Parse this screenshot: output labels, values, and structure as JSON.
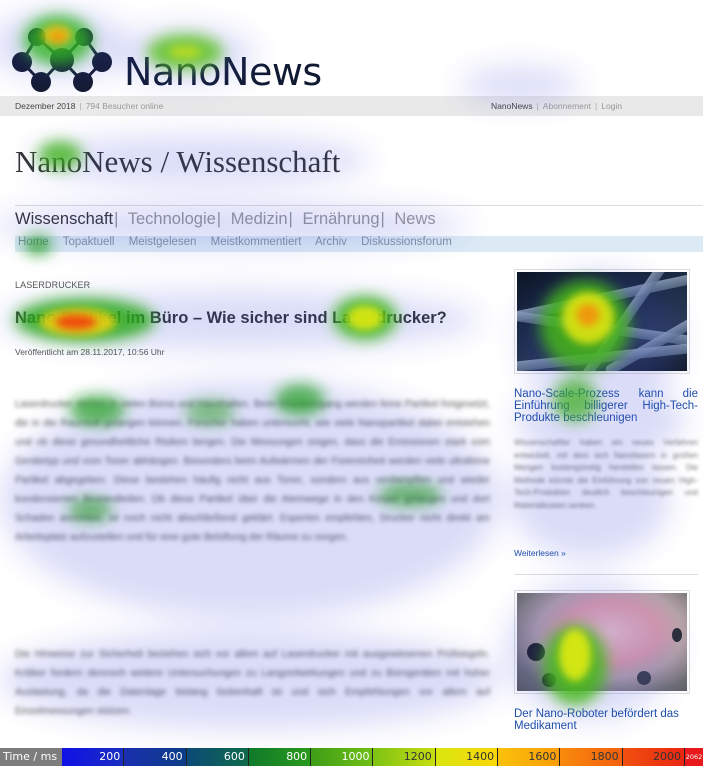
{
  "site": {
    "logo_text": "NanoNews",
    "topbar": {
      "date": "Dezember 2018",
      "visitors": "794 Besucher online",
      "links": [
        "NanoNews",
        "Abonnement",
        "Login"
      ]
    },
    "section_title": "NanoNews / Wissenschaft",
    "category_nav": [
      {
        "label": "Wissenschaft",
        "active": true
      },
      {
        "label": "Technologie",
        "active": false
      },
      {
        "label": "Medizin",
        "active": false
      },
      {
        "label": "Ernährung",
        "active": false
      },
      {
        "label": "News",
        "active": false
      }
    ],
    "sub_nav": [
      "Home",
      "Topaktuell",
      "Meistgelesen",
      "Meistkommentiert",
      "Archiv",
      "Diskussionsforum"
    ]
  },
  "article": {
    "kicker": "LASERDRUCKER",
    "headline": "Nano-Partikel im Büro – Wie sicher sind Laserdrucker?",
    "published": "Veröffentlicht am 28.11.2017, 10:56 Uhr",
    "paragraph_1": "Laserdrucker stehen in vielen Büros und Haushalten. Beim Druckvorgang werden feine Partikel freigesetzt, die in die Raumluft gelangen können. Forscher haben untersucht, wie viele Nanopartikel dabei entstehen und ob diese gesundheitliche Risiken bergen. Die Messungen zeigen, dass die Emissionen stark vom Gerätetyp und vom Toner abhängen. Besonders beim Aufwärmen der Fixiereinheit werden viele ultrafeine Partikel abgegeben. Diese bestehen häufig nicht aus Toner, sondern aus verdampften und wieder kondensierten Bestandteilen. Ob diese Partikel über die Atemwege in den Körper gelangen und dort Schaden anrichten, ist noch nicht abschließend geklärt. Experten empfehlen, Drucker nicht direkt am Arbeitsplatz aufzustellen und für eine gute Belüftung der Räume zu sorgen.",
    "paragraph_2": "Die Hinweise zur Sicherheit beziehen sich vor allem auf Laserdrucker mit ausgewiesenen Prüfsiegeln. Kritiker fordern dennoch weitere Untersuchungen zu Langzeitwirkungen und zu Bürogeräten mit hoher Auslastung, da die Datenlage bislang lückenhaft ist und sich Empfehlungen vor allem auf Einzelmessungen stützen."
  },
  "sidebar": {
    "items": [
      {
        "image_alt": "Elektronenmikroskopische Aufnahme von Nanofasern",
        "title": "Nano-Scale-Prozess kann die Einführung billigerer High-Tech-Produkte beschleunigen",
        "teaser": "Wissenschaftler haben ein neues Verfahren entwickelt, mit dem sich Nanofasern in großen Mengen kostengünstig herstellen lassen. Die Methode könnte die Einführung von neuen High-Tech-Produkten deutlich beschleunigen und Materialkosten senken.",
        "read_more": "Weiterlesen »"
      },
      {
        "image_alt": "Nano-Roboter an einer Zelle",
        "title": "Der Nano-Roboter befördert das Medikament"
      }
    ]
  },
  "heatmap_legend": {
    "label": "Time / ms",
    "ticks": [
      "200",
      "400",
      "600",
      "800",
      "1000",
      "1200",
      "1400",
      "1600",
      "1800",
      "2000"
    ],
    "max": "2062",
    "colors": [
      "#1a1ad6",
      "#0a3a8f",
      "#0f5a5e",
      "#118a1a",
      "#52a81c",
      "#a3cd14",
      "#f2e40a",
      "#f8a608",
      "#f26d0c",
      "#ee3210"
    ]
  },
  "heatmap_fixations": [
    {
      "region": "logo-mark",
      "intensity_ms": 1700
    },
    {
      "region": "logo-text",
      "intensity_ms": 1150
    },
    {
      "region": "section-title",
      "intensity_ms": 1000
    },
    {
      "region": "subnav-home",
      "intensity_ms": 800
    },
    {
      "region": "headline-start",
      "intensity_ms": 2000
    },
    {
      "region": "headline-laser",
      "intensity_ms": 1400
    },
    {
      "region": "sidebar-image-1",
      "intensity_ms": 1800
    },
    {
      "region": "sidebar-title-1",
      "intensity_ms": 900
    },
    {
      "region": "sidebar-image-2",
      "intensity_ms": 1400
    },
    {
      "region": "body-text",
      "intensity_ms": 800
    }
  ]
}
